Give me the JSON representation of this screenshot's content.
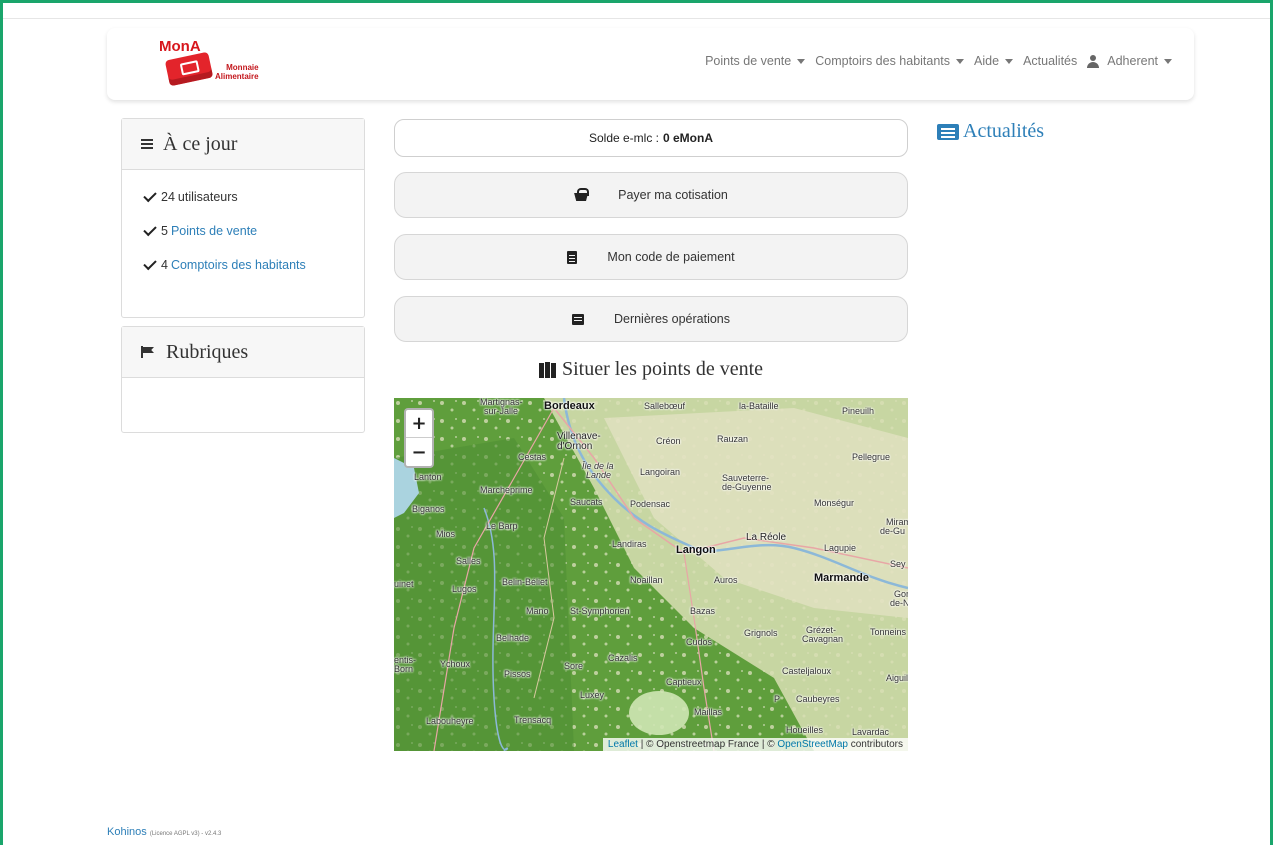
{
  "logo": {
    "mona": "MonA",
    "line1": "Monnaie",
    "line2": "Alimentaire"
  },
  "nav": {
    "points_de_vente": "Points de vente",
    "comptoirs": "Comptoirs des habitants",
    "aide": "Aide",
    "actualites": "Actualités",
    "adherent": "Adherent"
  },
  "stats_card": {
    "title": "À ce jour",
    "items": [
      {
        "count": "24",
        "label": "utilisateurs"
      },
      {
        "count": "5",
        "label": "Points de vente"
      },
      {
        "count": "4",
        "label": "Comptoirs des habitants"
      }
    ]
  },
  "rubriques_card": {
    "title": "Rubriques"
  },
  "solde": {
    "label": "Solde e-mlc :",
    "value": "0 eMonA"
  },
  "actions": {
    "cotisation": "Payer ma cotisation",
    "code": "Mon code de paiement",
    "operations": "Dernières opérations"
  },
  "map": {
    "title": "Situer les points de vente",
    "zoom_in": "+",
    "zoom_out": "−",
    "attribution_leaflet": "Leaflet",
    "attribution_mid": " | © Openstreetmap France | © ",
    "attribution_osm": "OpenStreetMap",
    "attribution_end": " contributors",
    "places": {
      "bordeaux": "Bordeaux",
      "martignas": "Martignas-",
      "martignas2": "sur-Jalle",
      "sallebouf": "Sallebœuf",
      "labataille": "la-Bataille",
      "pineuilh": "Pineuilh",
      "villenave": "Villenave-",
      "villenave2": "d'Ornon",
      "creon": "Créon",
      "rauzan": "Rauzan",
      "cestas": "Cestas",
      "pellegrue": "Pellegrue",
      "iledelalande": "Île de la",
      "iledelalande2": "Lande",
      "langoiran": "Langoiran",
      "sauveterre": "Sauveterre-",
      "sauveterre2": "de-Guyenne",
      "lanton": "Lanton",
      "marcheprime": "Marcheprime",
      "saucats": "Saucats",
      "podensac": "Podensac",
      "monsegur": "Monségur",
      "biganos": "Biganos",
      "lebarp": "Le Barp",
      "miramont": "Miram",
      "miramont2": "de-Gu",
      "mios": "Mios",
      "landiras": "Landiras",
      "langon": "Langon",
      "lareole": "La Réole",
      "lagupie": "Lagupie",
      "salles": "Salles",
      "seyches": "Sey",
      "guinet": "uinet",
      "lugos": "Lugos",
      "belinbeliet": "Belin-Béliet",
      "noaillan": "Noaillan",
      "auros": "Auros",
      "marmande": "Marmande",
      "gontaud": "Gor",
      "gontaud2": "de-N",
      "mano": "Mano",
      "stsymphorien": "St-Symphorien",
      "bazas": "Bazas",
      "tonneins": "Tonneins",
      "belhade": "Belhade",
      "grignols": "Grignols",
      "grezet": "Grézet-",
      "grezet2": "Cavagnan",
      "cudos": "Cudos",
      "gentis": "entis-",
      "gentis2": "Born",
      "ychoux": "Ychoux",
      "sore": "Sore",
      "cazalis": "Cazalis",
      "casteljaloux": "Casteljaloux",
      "aiguillon": "Aiguill",
      "pissos": "Pissos",
      "captieux": "Captieux",
      "luxey": "Luxey",
      "p": "P",
      "caubeyres": "Caubeyres",
      "maillas": "Maillas",
      "labouheyre": "Labouheyre",
      "trensacq": "Trensacq",
      "houeilles": "Houeilles",
      "lavardac": "Lavardac"
    }
  },
  "actualites": {
    "title": "Actualités"
  },
  "footer": {
    "brand": "Kohinos",
    "license": "(Licence AGPL v3) - v2.4.3"
  },
  "colors": {
    "frame": "#1aa56b",
    "link": "#2d7fb8",
    "brand_red": "#d7161c",
    "forest": "#5f9e3c"
  }
}
